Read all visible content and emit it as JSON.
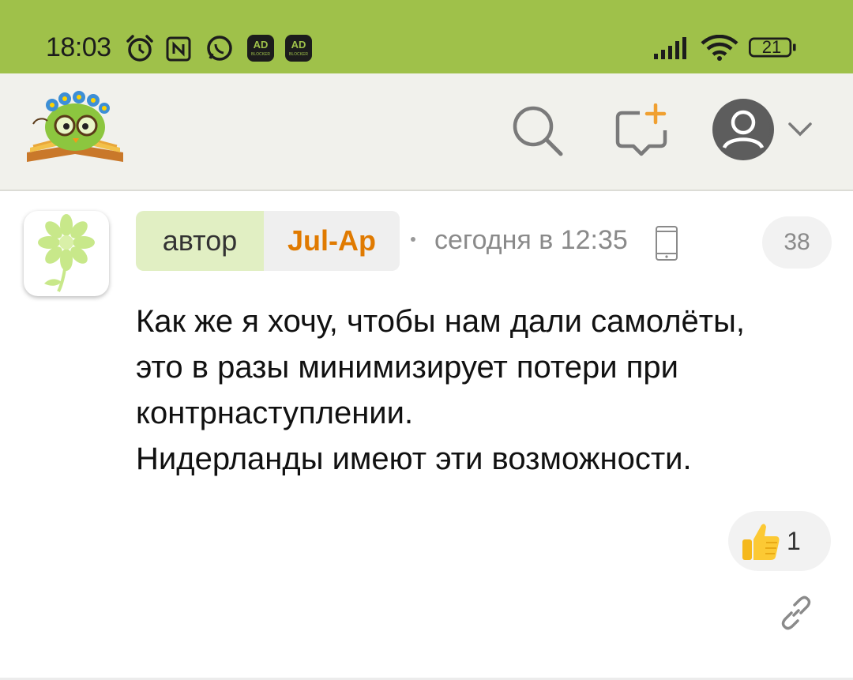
{
  "status_bar": {
    "time": "18:03",
    "battery": "21",
    "icons": [
      "alarm-icon",
      "nfc-icon",
      "whatsapp-icon",
      "ad-blocker-icon",
      "ad-blocker-icon",
      "signal-icon",
      "wifi-icon",
      "battery-icon"
    ],
    "adblock_label": "AD",
    "adblock_sub": "BLOCKER",
    "background": "#9fc14a"
  },
  "header": {
    "icons": [
      "logo-owl-icon",
      "search-icon",
      "new-message-icon",
      "profile-icon",
      "chevron-down-icon"
    ],
    "background": "#f1f1ec"
  },
  "comment": {
    "author_tag": "автор",
    "author_name": "Jul-Ap",
    "time": "сегодня в 12:35",
    "count": "38",
    "text_lines": [
      "Как же я хочу, чтобы нам дали самолёты,",
      "это в разы минимизирует потери при",
      "контрнаступлении.",
      "Нидерланды имеют эти возможности."
    ],
    "likes": "1",
    "colors": {
      "author_name": "#e07a00",
      "author_chip": "#e1efc3",
      "avatar_flower": "#c8e88a"
    }
  }
}
